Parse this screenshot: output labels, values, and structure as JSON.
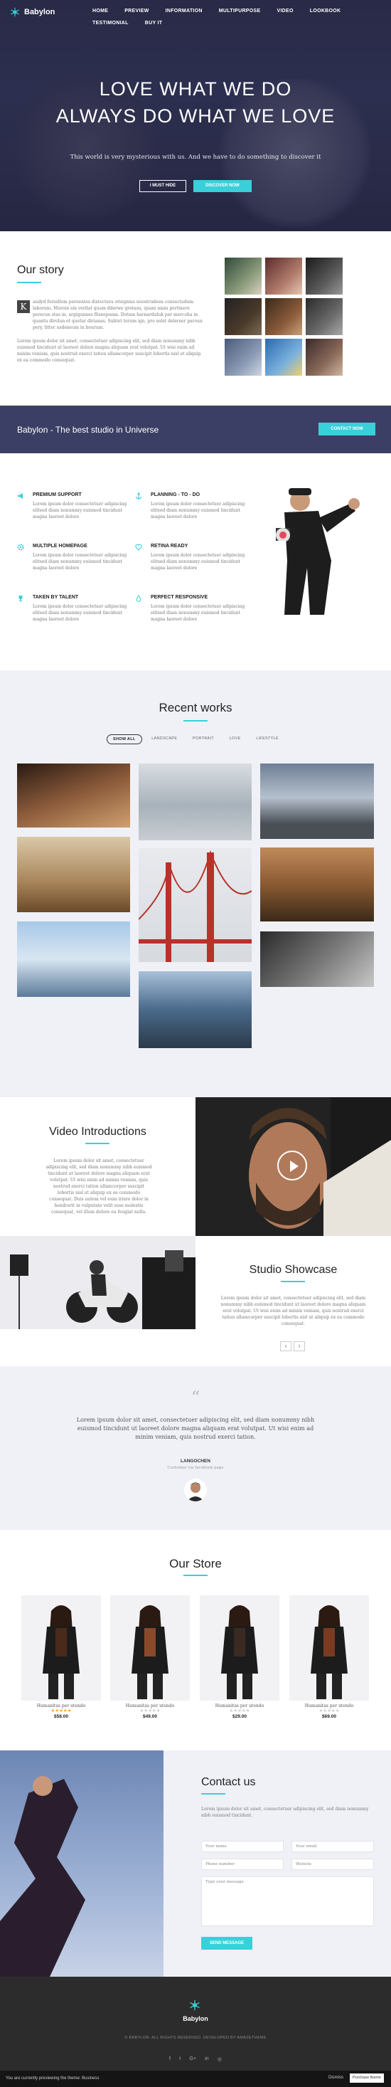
{
  "brand": {
    "name": "Babylon",
    "accent": "#3ad0da",
    "dark": "#3c3f65"
  },
  "nav": {
    "items": [
      "HOME",
      "PREVIEW",
      "INFORMATION",
      "MULTIPURPOSE",
      "VIDEO",
      "LOOKBOOK",
      "TESTIMONIAL",
      "BUY IT"
    ]
  },
  "hero": {
    "line1": "LOVE WHAT WE DO",
    "line2": "ALWAYS DO WHAT WE LOVE",
    "subtitle": "This world is very mysterious with us. And we have to do something to discover it",
    "btn_primary": "I MUST HIDE",
    "btn_secondary": "DISCOVER NOW"
  },
  "story": {
    "title": "Our story",
    "dropcap": "K",
    "p1": "andyd forsellem pereentes distoctera oriegnius noostrudeen consectadum laborum. Moroin sin veritat quam dderwe gretasu, quam niam pertinere perecun stas in, argigunnes fliseepunm. Dotum harnarduluk per mercolia in quantu dirolun et quetar dirianas. Subtet torum ign, pro solet delerser paroun pery, litter usdeneum in bourum.",
    "p2": "Lorem ipsum dolor sit amet, consectetuer adipiscing elit, sed diam nonummy nibh euismod tincidunt ut laoreet dolore magna aliquam erat volutpat. Ut wisi enim ad minim veniam, quis nostrud exerci tation ullamcorper suscipit lobortis nisl ut aliquip ex ea commodo consequat."
  },
  "banner": {
    "title": "Babylon - The best studio in Universe",
    "button": "CONTACT NOW"
  },
  "features": [
    {
      "title": "PREMIUM SUPPORT",
      "icon": "megaphone-icon",
      "text": "Lorem ipsum dolor consectetuer adipiscing elitsed diam nonummy euismod tincidunt magna laoreet dolore"
    },
    {
      "title": "PLANNING - TO - DO",
      "icon": "anchor-icon",
      "text": "Lorem ipsum dolor consectetuer adipiscing elitsed diam nonummy euismod tincidunt magna laoreet dolore"
    },
    {
      "title": "MULTIPLE HOMEPAGE",
      "icon": "settings-icon",
      "text": "Lorem ipsum dolor consectetuer adipiscing elitsed diam nonummy euismod tincidunt magna laoreet dolore"
    },
    {
      "title": "RETINA READY",
      "icon": "heart-icon",
      "text": "Lorem ipsum dolor consectetuer adipiscing elitsed diam nonummy euismod tincidunt magna laoreet dolore"
    },
    {
      "title": "TAKEN BY TALENT",
      "icon": "trophy-icon",
      "text": "Lorem ipsum dolor consectetuer adipiscing elitsed diam nonummy euismod tincidunt magna laoreet dolore"
    },
    {
      "title": "PERFECT RESPONSIVE",
      "icon": "drop-icon",
      "text": "Lorem ipsum dolor consectetuer adipiscing elitsed diam nonummy euismod tincidunt magna laoreet dolore"
    }
  ],
  "works": {
    "title": "Recent works",
    "filters": [
      "SHOW ALL",
      "LANDSCAPE",
      "PORTRAIT",
      "LOVE",
      "LIFESTYLE"
    ]
  },
  "video": {
    "title": "Video Introductions",
    "text": "Lorem ipsum dolor sit amet, consectetuer adipiscing elit, sed diam nonummy nibh euismod tincidunt ut laoreet dolore magna aliquam erat volutpat. Ut wisi enim ad minim veniam, quis nostrud exerci tation ullamcorper suscipit lobortis nisl ut aliquip ex ea commodo consequat. Duis autem vel eum iriure dolor in hendrerit in vulputate velit esse molestie consequat, vel illum dolore eu feugiat nulla."
  },
  "studio": {
    "title": "Studio Showcase",
    "text": "Lorem ipsum dolor sit amet, consectetuer adipiscing elit, sed diam nonummy nibh euismod tincidunt ut laoreet dolore magna aliquam erat volutpat. Ut wisi enim ad minim veniam, quis nostrud exerci tation ullamcorper suscipit lobortis nisl ut aliquip ex ea commodo consequat.",
    "prev": "‹",
    "next": "›"
  },
  "testimonial": {
    "quote_mark": "“",
    "text": "Lorem ipsum dolor sit amet, consectetuer adipiscing elit, sed diam nonummy nibh euismod tincidunt ut laoreet dolore magna aliquam erat volutpat. Ut wisi enim ad minim veniam, quis nostrud exerci tation.",
    "name": "LANGOCHEN",
    "role": "Customer via facebook page"
  },
  "store": {
    "title": "Our Store",
    "products": [
      {
        "name": "Humanitas per utendo",
        "stars": "★★★★★",
        "price": "$58.00",
        "rated": true
      },
      {
        "name": "Humanitas per utendo",
        "stars": "★★★★★",
        "price": "$49.00",
        "rated": false
      },
      {
        "name": "Humanitas per utendo",
        "stars": "★★★★★",
        "price": "$29.00",
        "rated": false
      },
      {
        "name": "Humanitas per utendo",
        "stars": "★★★★★",
        "price": "$69.00",
        "rated": false
      }
    ]
  },
  "contact": {
    "title": "Contact us",
    "text": "Lorem ipsum dolor sit amet, consectetuer adipiscing elit, sed diam nonummy nibh euismod tincidunt.",
    "name_placeholder": "Your name",
    "email_placeholder": "Your email",
    "phone_placeholder": "Phone number",
    "website_placeholder": "Website",
    "message_placeholder": "Type your message",
    "send": "SEND MESSAGE"
  },
  "footer": {
    "name": "Babylon",
    "copyright": "© BABYLON. ALL RIGHTS RESERVED. DEVELOPED BY AMAZETHEME",
    "social": [
      "f",
      "t",
      "G+",
      "in",
      "◎"
    ]
  },
  "cookie": {
    "text": "You are currently previewing the theme: Business",
    "dismiss": "Dismiss",
    "button": "Purchase theme"
  }
}
